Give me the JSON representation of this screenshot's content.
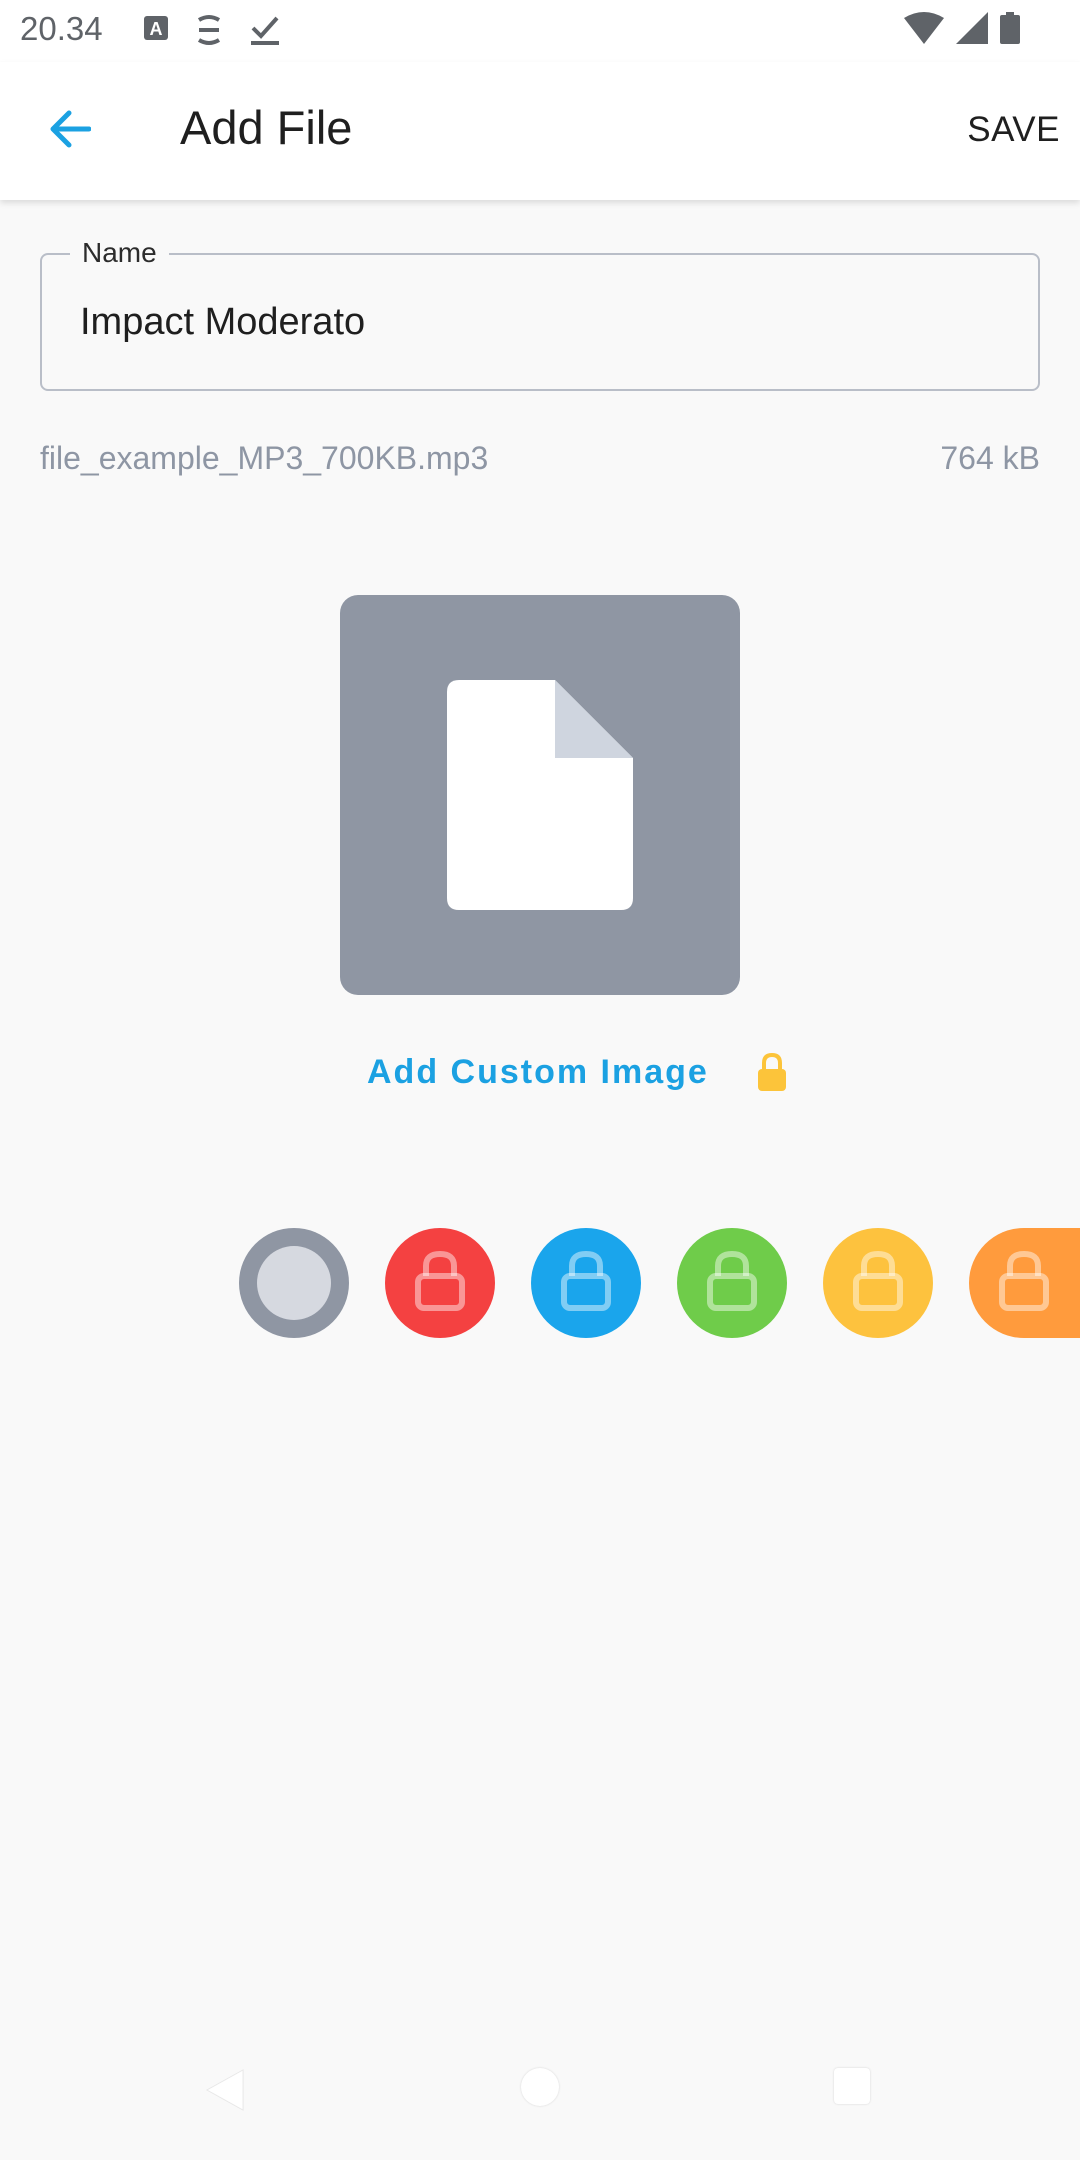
{
  "status_bar": {
    "time": "20.34",
    "left_icons": [
      "keyboard-a-icon",
      "spellcheck-icon",
      "download-check-icon"
    ],
    "right_icons": [
      "wifi-icon",
      "signal-icon",
      "battery-icon"
    ]
  },
  "app_bar": {
    "back_icon": "arrow-left-icon",
    "title": "Add File",
    "save_label": "SAVE"
  },
  "form": {
    "name_label": "Name",
    "name_value": "Impact Moderato"
  },
  "file": {
    "filename": "file_example_MP3_700KB.mp3",
    "size": "764 kB"
  },
  "thumbnail": {
    "icon": "document-icon"
  },
  "custom_image": {
    "label": "Add Custom Image",
    "lock_icon": "lock-icon"
  },
  "colors": {
    "accent": "#1ba1e2",
    "lock_yellow": "#fcc43a",
    "swatches": [
      {
        "name": "gray",
        "color": "#8f96a3",
        "selected": true
      },
      {
        "name": "red",
        "color": "#f44141",
        "locked": true
      },
      {
        "name": "blue",
        "color": "#1aa5ec",
        "locked": true
      },
      {
        "name": "green",
        "color": "#6fcc4a",
        "locked": true
      },
      {
        "name": "yellow",
        "color": "#fdc23e",
        "locked": true
      },
      {
        "name": "orange",
        "color": "#ff9b3d",
        "locked": true
      }
    ]
  }
}
